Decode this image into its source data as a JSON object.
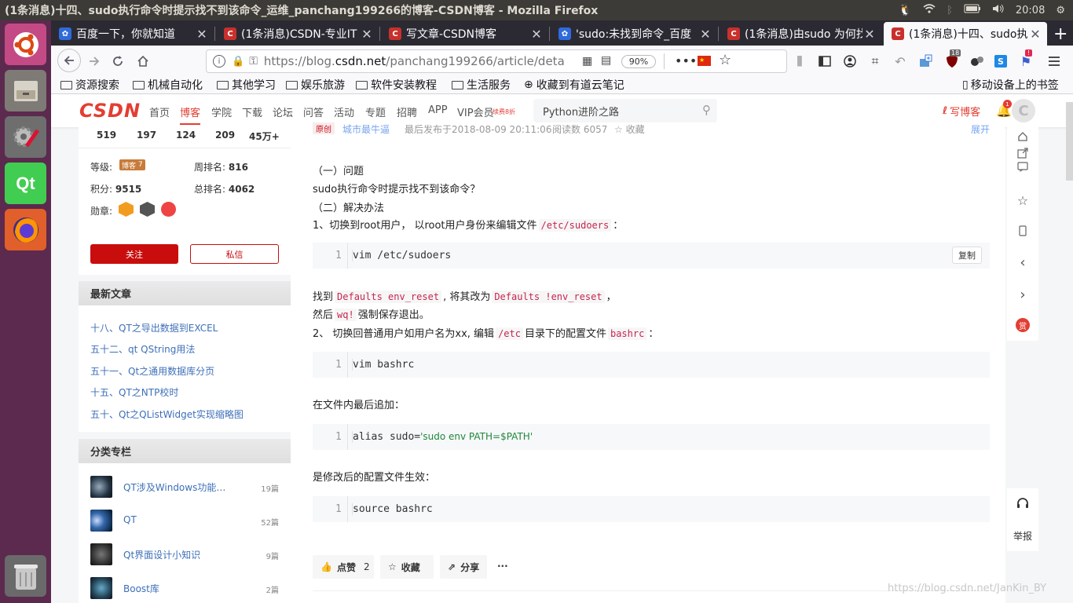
{
  "window_title": "(1条消息)十四、sudo执行命令时提示找不到该命令_运维_panchang199266的博客-CSDN博客 - Mozilla Firefox",
  "tray": {
    "badge": "1",
    "time": "20:08"
  },
  "tabs": [
    {
      "label": "百度一下，你就知道"
    },
    {
      "label": "(1条消息)CSDN-专业IT"
    },
    {
      "label": "写文章-CSDN博客"
    },
    {
      "label": "'sudo:未找到命令_百度"
    },
    {
      "label": "(1条消息)由sudo 为何找"
    },
    {
      "label": "(1条消息)十四、sudo执"
    }
  ],
  "new_tab": "+",
  "url": {
    "prefix": "https://blog.",
    "domain": "csdn.net",
    "path": "/panchang199266/article/deta",
    "zoom": "90%"
  },
  "ext_badge": "18",
  "ext_badge2": "!",
  "bookmarks": [
    "资源搜索",
    "机械自动化",
    "其他学习",
    "娱乐旅游",
    "软件安装教程",
    "生活服务",
    "收藏到有道云笔记"
  ],
  "mobile_bookmarks": "移动设备上的书签",
  "csdn": {
    "logo": "CSDN",
    "nav": [
      "首页",
      "博客",
      "学院",
      "下载",
      "论坛",
      "问答",
      "活动",
      "专题",
      "招聘",
      "APP",
      "VIP会员"
    ],
    "vip_tag": "续费8折",
    "search_placeholder": "Python进阶之路",
    "write": "写博客",
    "notif_count": "1"
  },
  "profile": {
    "stats": [
      "519",
      "197",
      "124",
      "209",
      "45万+"
    ],
    "level_label": "等级:",
    "level_badge": "博客",
    "level_num": "7",
    "weekrank_label": "周排名:",
    "weekrank": "816",
    "points_label": "积分:",
    "points": "9515",
    "totalrank_label": "总排名:",
    "totalrank": "4062",
    "medals_label": "勋章:",
    "follow": "关注",
    "message": "私信"
  },
  "recent": {
    "title": "最新文章",
    "items": [
      "十八、QT之导出数据到EXCEL",
      "五十二、qt QString用法",
      "五十一、Qt之通用数据库分页",
      "十五、QT之NTP校时",
      "五十、Qt之QListWidget实现缩略图"
    ]
  },
  "categories": {
    "title": "分类专栏",
    "items": [
      {
        "name": "QT涉及Windows功能…",
        "count": "19篇"
      },
      {
        "name": "QT",
        "count": "52篇"
      },
      {
        "name": "Qt界面设计小知识",
        "count": "9篇"
      },
      {
        "name": "Boost库",
        "count": "2篇"
      }
    ]
  },
  "article": {
    "header": {
      "tag": "原创",
      "author": "城市最牛逼",
      "date": "最后发布于2018-08-09 20:11:06",
      "reads": "阅读数 6057",
      "fav": "收藏",
      "expand": "展开"
    },
    "p1": "（一）问题",
    "p2": "sudo执行命令时提示找不到该命令？",
    "p3": "（二）解决办法",
    "p4a": "1、切换到root用户， 以root用户身份来编辑文件",
    "p4code": "/etc/sudoers",
    "p4b": "：",
    "code1": {
      "ln": "1",
      "text": "vim /etc/sudoers",
      "copy": "复制"
    },
    "p5a": "找到",
    "p5c1": "Defaults env_reset",
    "p5b": ", 将其改为",
    "p5c2": "Defaults !env_reset",
    "p5d": "，",
    "p6a": "然后",
    "p6c": "wq!",
    "p6b": "强制保存退出。",
    "p7a": "2、 切换回普通用户如用户名为xx, 编辑",
    "p7c1": "/etc",
    "p7b": "目录下的配置文件",
    "p7c2": "bashrc",
    "p7d": "：",
    "code2": {
      "ln": "1",
      "text": "vim bashrc"
    },
    "p8": "在文件内最后追加：",
    "code3": {
      "ln": "1",
      "prefix": "alias sudo=",
      "str": "'sudo env PATH=$PATH'"
    },
    "p9": "是修改后的配置文件生效：",
    "code4": {
      "ln": "1",
      "text": "source bashrc"
    },
    "actions": {
      "like": "点赞",
      "like_count": "2",
      "fav": "收藏",
      "share": "分享",
      "more": "···"
    }
  },
  "right_tools": {
    "reward": "赏",
    "report": "举报"
  },
  "watermark": "https://blog.csdn.net/JanKin_BY"
}
